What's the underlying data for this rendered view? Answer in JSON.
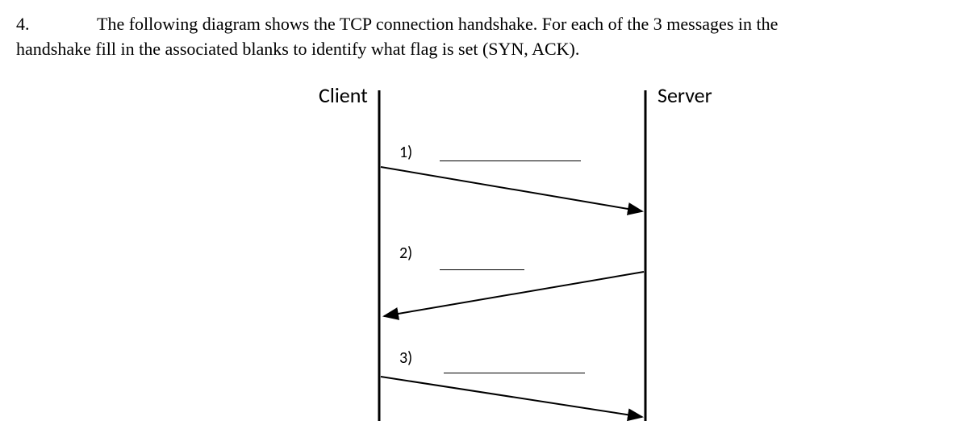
{
  "question": {
    "number": "4.",
    "text_part1": "The following diagram shows the TCP connection handshake. For each of the 3 messages in the",
    "text_part2": "handshake fill in the associated blanks to identify what flag is set (SYN, ACK)."
  },
  "diagram": {
    "client_label": "Client",
    "server_label": "Server",
    "messages": [
      {
        "label": "1)",
        "blank": ""
      },
      {
        "label": "2)",
        "blank": ""
      },
      {
        "label": "3)",
        "blank": ""
      }
    ]
  }
}
